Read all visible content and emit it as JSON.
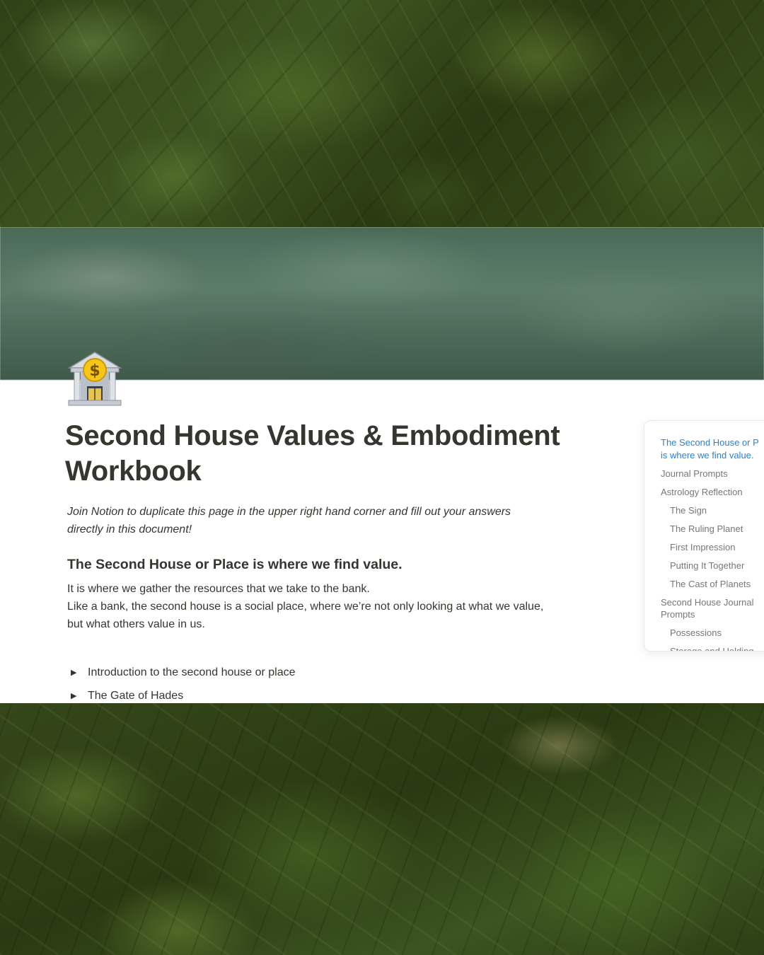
{
  "page": {
    "title_line1": "Second House Values & Embodiment",
    "title_line2": "Workbook",
    "intro_line1": "Join Notion to duplicate this page in the upper right hand corner and fill out your answers",
    "intro_line2": "directly in this document!",
    "heading": "The Second House or Place is where we find value.",
    "body_line1": "It is where we gather the resources that we take to the bank.",
    "body_line2": "Like a bank, the second house is a social place, where we’re not only looking at what we value,",
    "body_line3": "but what others value in us.",
    "toggles": [
      {
        "label": "Introduction to the second house or place"
      },
      {
        "label": "The Gate of Hades"
      }
    ],
    "icon": "bank-dollar-icon"
  },
  "toc": {
    "items": [
      {
        "line1": "The Second House or P",
        "line2": "is where we find value.",
        "active": true
      },
      {
        "line1": "Journal Prompts"
      },
      {
        "line1": "Astrology Reflection"
      },
      {
        "line1": "The Sign"
      },
      {
        "line1": "The Ruling Planet"
      },
      {
        "line1": "First Impression"
      },
      {
        "line1": "Putting It Together"
      },
      {
        "line1": "The Cast of Planets"
      },
      {
        "line1": "Second House Journal",
        "line2": "Prompts"
      },
      {
        "line1": "Possessions"
      },
      {
        "line1": "Storage and Holding"
      }
    ]
  },
  "colors": {
    "text": "#37352f",
    "muted": "#787774",
    "accent": "#2383e2",
    "background_foliage": "#2c3a16"
  }
}
